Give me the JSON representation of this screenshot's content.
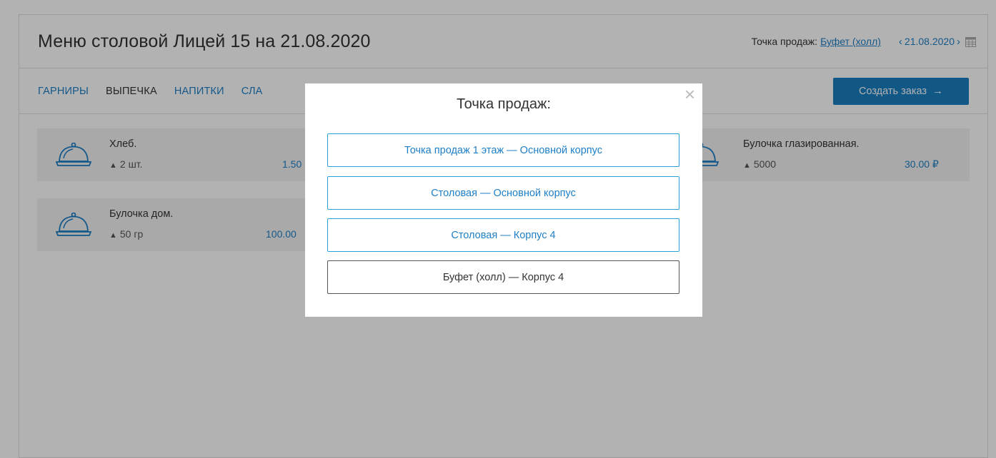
{
  "header": {
    "title": "Меню столовой Лицей 15 на 21.08.2020",
    "sale_point_label": "Точка продаж:",
    "sale_point_value": "Буфет (холл)",
    "date": "21.08.2020",
    "prev_icon": "‹",
    "next_icon": "›"
  },
  "tabs": [
    {
      "label": "ГАРНИРЫ",
      "active": false
    },
    {
      "label": "ВЫПЕЧКА",
      "active": true
    },
    {
      "label": "НАПИТКИ",
      "active": false
    },
    {
      "label": "СЛА",
      "active": false
    }
  ],
  "create_order": {
    "label": "Создать заказ",
    "arrow": "→"
  },
  "menu_items": [
    {
      "name": "Хлеб.",
      "weight": "2 шт.",
      "price": "1.50"
    },
    {
      "name": "Булочка дом.",
      "weight": "50 гр",
      "price": "100.00"
    },
    {
      "name": "Булочка глазированная.",
      "weight": "5000",
      "price": "30.00 ₽"
    }
  ],
  "modal": {
    "title": "Точка продаж:",
    "close": "×",
    "options": [
      {
        "label": "Точка продаж 1 этаж — Основной корпус",
        "selected": false
      },
      {
        "label": "Столовая — Основной корпус",
        "selected": false
      },
      {
        "label": "Столовая — Корпус 4",
        "selected": false
      },
      {
        "label": "Буфет (холл) — Корпус 4",
        "selected": true
      }
    ]
  },
  "colors": {
    "accent": "#1e7fc6",
    "button": "#1a7fc1",
    "option_border": "#29a0d8"
  }
}
